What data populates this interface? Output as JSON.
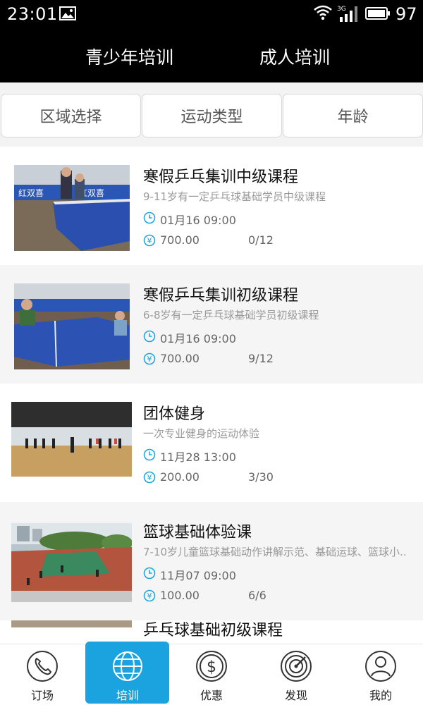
{
  "status_bar": {
    "time": "23:01",
    "battery": "97",
    "network": "3G"
  },
  "top_tabs": [
    {
      "label": "青少年培训"
    },
    {
      "label": "成人培训"
    }
  ],
  "filters": [
    {
      "label": "区域选择"
    },
    {
      "label": "运动类型"
    },
    {
      "label": "年龄"
    }
  ],
  "courses": [
    {
      "title": "寒假乒乓集训中级课程",
      "desc": "9-11岁有一定乒乓球基础学员中级课程",
      "date": "01月16 09:00",
      "price": "700.00",
      "count": "0/12"
    },
    {
      "title": "寒假乒乓集训初级课程",
      "desc": "6-8岁有一定乒乓球基础学员初级课程",
      "date": "01月16 09:00",
      "price": "700.00",
      "count": "9/12"
    },
    {
      "title": "团体健身",
      "desc": "一次专业健身的运动体验",
      "date": "11月28 13:00",
      "price": "200.00",
      "count": "3/30"
    },
    {
      "title": "篮球基础体验课",
      "desc": "7-10岁儿童篮球基础动作讲解示范、基础运球、篮球小..",
      "date": "11月07 09:00",
      "price": "100.00",
      "count": "6/6"
    },
    {
      "title": "乒乓球基础初级课程"
    }
  ],
  "bottom_nav": [
    {
      "label": "订场",
      "icon": "phone-icon"
    },
    {
      "label": "培训",
      "icon": "globe-icon"
    },
    {
      "label": "优惠",
      "icon": "dollar-icon"
    },
    {
      "label": "发现",
      "icon": "radar-icon"
    },
    {
      "label": "我的",
      "icon": "user-icon"
    }
  ],
  "colors": {
    "accent": "#1aa3de",
    "header_bg": "#000000",
    "alt_row": "#f5f5f5"
  }
}
